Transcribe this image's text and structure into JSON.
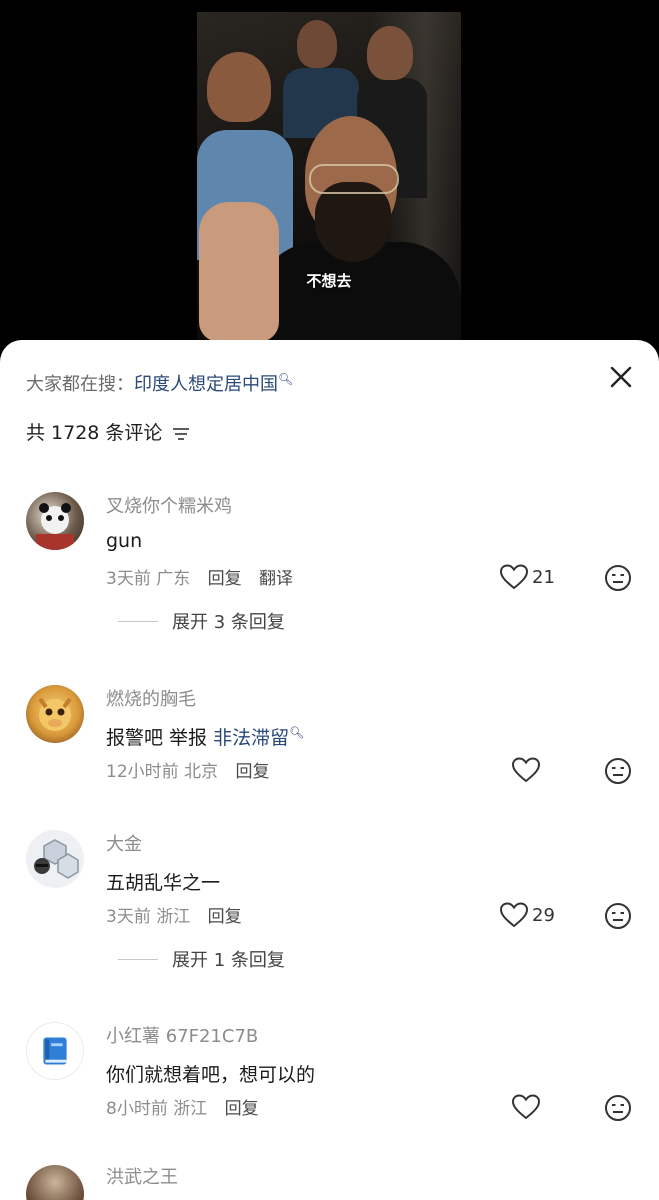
{
  "video": {
    "caption": "不想去"
  },
  "search_hint": {
    "prefix": "大家都在搜：",
    "query": "印度人想定居中国"
  },
  "comment_count_label": "共 1728 条评论",
  "comments": [
    {
      "author": "叉烧你个糯米鸡",
      "text": "gun",
      "time": "3天前",
      "location": "广东",
      "reply_label": "回复",
      "translate_label": "翻译",
      "likes": "21",
      "expand_label": "展开 3 条回复"
    },
    {
      "author": "燃烧的胸毛",
      "text_plain": "报警吧 举报",
      "text_link": "非法滞留",
      "time": "12小时前",
      "location": "北京",
      "reply_label": "回复",
      "likes": ""
    },
    {
      "author": "大金",
      "text": "五胡乱华之一",
      "time": "3天前",
      "location": "浙江",
      "reply_label": "回复",
      "likes": "29",
      "expand_label": "展开 1 条回复"
    },
    {
      "author": "小红薯 67F21C7B",
      "text": "你们就想着吧，想可以的",
      "time": "8小时前",
      "location": "浙江",
      "reply_label": "回复",
      "likes": ""
    },
    {
      "author": "洪武之王"
    }
  ],
  "colors": {
    "link": "#2b4a78",
    "secondary_text": "#8d8d8d",
    "sheet_bg": "#ffffff"
  },
  "icons": [
    "close-icon",
    "filter-icon",
    "heart-icon",
    "emoji-icon",
    "search-icon"
  ]
}
